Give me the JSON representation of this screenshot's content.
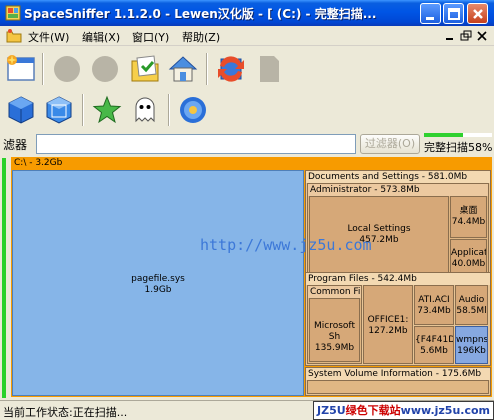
{
  "window": {
    "title": "SpaceSniffer 1.1.2.0 - Lewen汉化版 - [ (C:) - 完整扫描..."
  },
  "menu": [
    {
      "label": "文件(W)"
    },
    {
      "label": "编辑(X)"
    },
    {
      "label": "窗口(Y)"
    },
    {
      "label": "帮助(Z)"
    }
  ],
  "filter": {
    "label": "滤器",
    "value": "",
    "button_label": "过滤器(O)"
  },
  "scan": {
    "label": "完整扫描58%",
    "progress": 0.58
  },
  "treemap": {
    "root": {
      "label": "C:\\ - 3.2Gb"
    },
    "pagefile": {
      "name": "pagefile.sys",
      "size": "1.9Gb"
    },
    "docs": {
      "label": "Documents and Settings - 581.0Mb"
    },
    "admin": {
      "label": "Administrator - 573.8Mb"
    },
    "local_settings": {
      "name": "Local Settings",
      "size": "457.2Mb"
    },
    "desktop": {
      "name": "桌面",
      "size": "74.4Mb"
    },
    "applic": {
      "name": "Applicat",
      "size": "40.0Mb"
    },
    "program_files": {
      "label": "Program Files - 542.4Mb"
    },
    "common": {
      "label": "Common File"
    },
    "microsoft": {
      "name": "Microsoft Sh",
      "size": "135.9Mb"
    },
    "office": {
      "name": "OFFICE1:",
      "size": "127.2Mb"
    },
    "ati": {
      "name": "ATI.ACI",
      "size": "73.4Mb"
    },
    "audio": {
      "name": "Audio",
      "size": "58.5Ml"
    },
    "f4f": {
      "name": "{F4F41D",
      "size": "5.6Mb"
    },
    "wmpns": {
      "name": "wmpns",
      "size": "196Kb"
    },
    "svi": {
      "label": "System Volume Information - 175.6Mb"
    }
  },
  "watermark": "http://www.jz5u.com",
  "status": {
    "text": "当前工作状态:正在扫描..."
  },
  "badge": {
    "part1": "JZ5U",
    "part2": "绿色下载站",
    "part3": "www.jz5u.com"
  },
  "colors": {
    "titlebar": "#0055e5",
    "treemap_root": "#f79b00",
    "pagefile": "#86b5e8",
    "folder": "#d6a878",
    "subfolder": "#d2a26c",
    "selected": "#86a8e0",
    "progress": "#2fd12f"
  }
}
